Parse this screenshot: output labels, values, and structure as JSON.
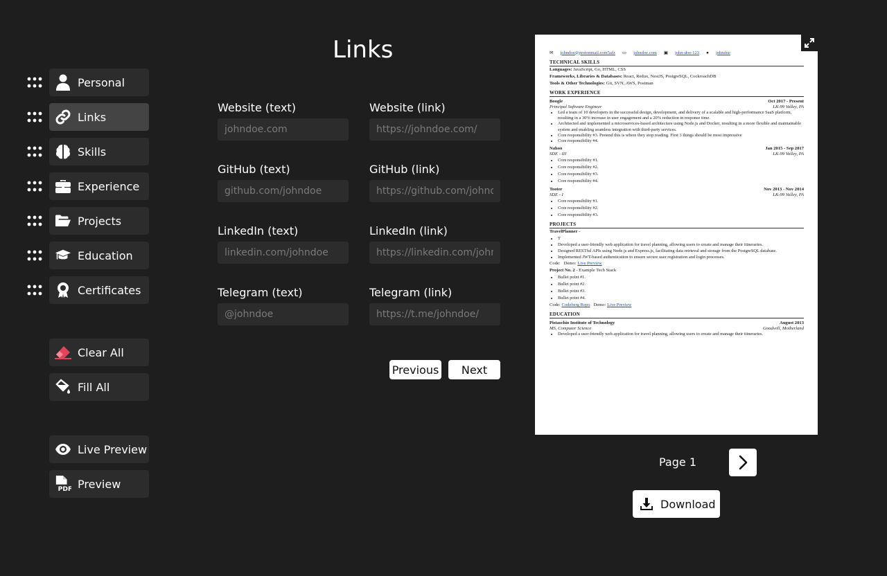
{
  "sidebar": {
    "sections": [
      {
        "label": "Personal",
        "icon": "user-icon"
      },
      {
        "label": "Links",
        "icon": "link-icon",
        "active": true
      },
      {
        "label": "Skills",
        "icon": "brain-icon"
      },
      {
        "label": "Experience",
        "icon": "briefcase-icon"
      },
      {
        "label": "Projects",
        "icon": "folder-open-icon"
      },
      {
        "label": "Education",
        "icon": "graduation-cap-icon"
      },
      {
        "label": "Certificates",
        "icon": "award-icon"
      }
    ],
    "clear_all": "Clear All",
    "fill_all": "Fill All",
    "live_preview": "Live Preview",
    "preview": "Preview"
  },
  "form": {
    "title": "Links",
    "fields": [
      {
        "label": "Website (text)",
        "placeholder": "johndoe.com"
      },
      {
        "label": "Website (link)",
        "placeholder": "https://johndoe.com/"
      },
      {
        "label": "GitHub (text)",
        "placeholder": "github.com/johndoe"
      },
      {
        "label": "GitHub (link)",
        "placeholder": "https://github.com/johndoe/"
      },
      {
        "label": "LinkedIn (text)",
        "placeholder": "linkedin.com/johndoe"
      },
      {
        "label": "LinkedIn (link)",
        "placeholder": "https://linkedin.com/johndoe/"
      },
      {
        "label": "Telegram (text)",
        "placeholder": "@johndoe"
      },
      {
        "label": "Telegram (link)",
        "placeholder": "https://t.me/johndoe/"
      }
    ],
    "previous": "Previous",
    "next": "Next"
  },
  "resume": {
    "contact": [
      "johndoe@protonmail.com5afz",
      "johndoe.com",
      "john-doe-123",
      "johndoe"
    ],
    "tech_heading": "TECHNICAL SKILLS",
    "skills": [
      {
        "k": "Languages:",
        "v": "JavaScript, Go, HTML, CSS"
      },
      {
        "k": "Frameworks, Libraries & Databases:",
        "v": "React, Redux, NestJS, PostgreSQL, CockroachDB"
      },
      {
        "k": "Tools & Other Technologies:",
        "v": "Git, SVN, AWS, Postman"
      }
    ],
    "work_heading": "WORK EXPERIENCE",
    "jobs": [
      {
        "company": "Boogle",
        "dates": "Oct 2017 - Present",
        "role": "Principal Software Engineer",
        "location": "LK-99 Valley, PA",
        "bullets": [
          "Led a team of 10 developers in the successful design, development, and delivery of a scalable and high-performance SaaS platform, resulting in a 30% increase in user engagement and a 20% reduction in response time.",
          "Architected and implemented a microservices-based architecture using Node.js and Docker, resulting in a more flexible and maintainable system and enabling seamless integration with third-party services.",
          "Core responsibility #3. Pretend this is where they stop reading. First 3 things should be most impressive",
          "Core responsibility #4.",
          ""
        ]
      },
      {
        "company": "Nahoo",
        "dates": "Jan 2015 - Sep 2017",
        "role": "SDE - III",
        "location": "LK-99 Valley, PA",
        "bullets": [
          "Core responsibility #1.",
          "Core responsibility #2.",
          "Core responsibility #3.",
          "Core responsibility #4."
        ]
      },
      {
        "company": "Tooter",
        "dates": "Nov 2013 - Nov 2014",
        "role": "SDE - I",
        "location": "LK-99 Valley, PA",
        "bullets": [
          "Core responsibility #1.",
          "Core responsibility #2.",
          "Core responsibility #3.",
          ""
        ]
      }
    ],
    "projects_heading": "PROJECTS",
    "project1": {
      "name": "TravelPlanner",
      "suffix": " -",
      "bullets": [
        "T",
        "Developed a user-friendly web application for travel planning, allowing users to create and manage their itineraries.",
        "Designed RESTful APIs using Node.js and Express.js, facilitating data retrieval and storage from the PostgreSQL database.",
        "Implemented JWT-based authentication to ensure secure user registration and login processes."
      ],
      "code_label": "Code:",
      "demo_label": "Demo:",
      "demo_link": "Live Preview"
    },
    "project2": {
      "name": "Project No. 2",
      "stack": " - Example Tech Stack",
      "bullets": [
        "Bullet point #1.",
        "Bullet point #2.",
        "Bullet point #3.",
        "Bullet point #4."
      ],
      "code_label": "Code:",
      "code_link": "Codeberg Repo",
      "demo_label": "Demo:",
      "demo_link": "Live Preview"
    },
    "education_heading": "EDUCATION",
    "school": {
      "name": "Pistaschio Institute of Technology",
      "date": "August 2013",
      "degree": "MS, Computer Science",
      "location": "Goodwill, Motherland",
      "bullets": [
        "Developed a user-friendly web application for travel planning, allowing users to create and manage their itineraries."
      ]
    }
  },
  "pager": {
    "page_label": "Page 1",
    "download": "Download"
  }
}
